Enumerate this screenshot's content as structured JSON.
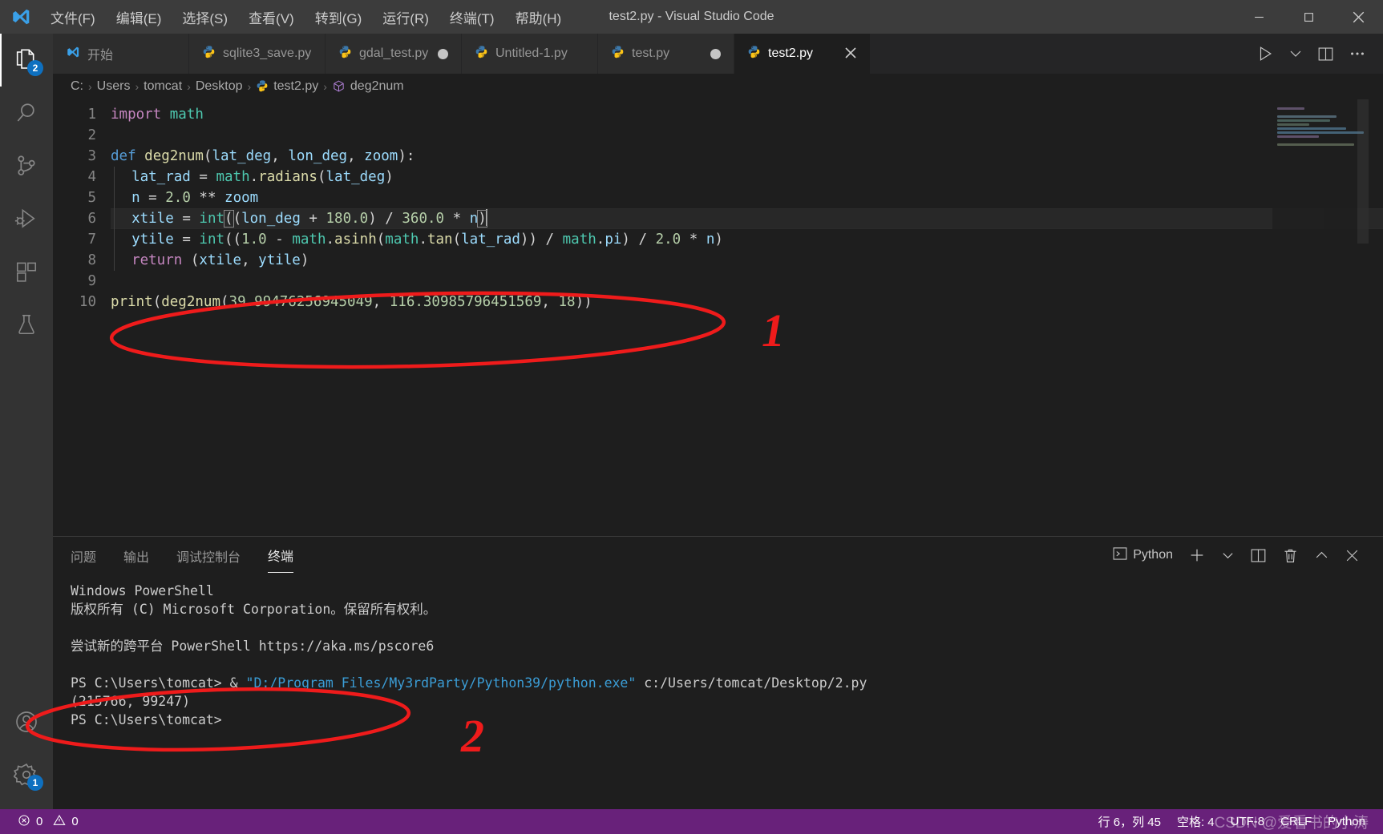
{
  "window": {
    "title": "test2.py - Visual Studio Code",
    "minimize_label": "─",
    "maximize_label": "□",
    "close_label": "✕"
  },
  "menu": {
    "items": [
      {
        "label": "文件(F)",
        "name": "menu-file"
      },
      {
        "label": "编辑(E)",
        "name": "menu-edit"
      },
      {
        "label": "选择(S)",
        "name": "menu-selection"
      },
      {
        "label": "查看(V)",
        "name": "menu-view"
      },
      {
        "label": "转到(G)",
        "name": "menu-go"
      },
      {
        "label": "运行(R)",
        "name": "menu-run"
      },
      {
        "label": "终端(T)",
        "name": "menu-terminal"
      },
      {
        "label": "帮助(H)",
        "name": "menu-help"
      }
    ]
  },
  "activitybar": {
    "items": [
      {
        "name": "explorer-icon",
        "label": "Explorer",
        "badge": "2",
        "active": true
      },
      {
        "name": "search-icon",
        "label": "Search",
        "badge": "",
        "active": false
      },
      {
        "name": "source-control-icon",
        "label": "Source Control",
        "badge": "",
        "active": false
      },
      {
        "name": "run-debug-icon",
        "label": "Run and Debug",
        "badge": "",
        "active": false
      },
      {
        "name": "extensions-icon",
        "label": "Extensions",
        "badge": "",
        "active": false
      },
      {
        "name": "testing-icon",
        "label": "Testing",
        "badge": "",
        "active": false
      }
    ],
    "bottom": [
      {
        "name": "account-icon",
        "label": "Accounts",
        "badge": ""
      },
      {
        "name": "settings-gear-icon",
        "label": "Manage",
        "badge": "1"
      }
    ]
  },
  "tabs": [
    {
      "label": "开始",
      "icon": "vscode-icon",
      "dirty": false,
      "active": false,
      "closable": false
    },
    {
      "label": "sqlite3_save.py",
      "icon": "python-icon",
      "dirty": false,
      "active": false,
      "closable": false
    },
    {
      "label": "gdal_test.py",
      "icon": "python-icon",
      "dirty": true,
      "active": false,
      "closable": false
    },
    {
      "label": "Untitled-1.py",
      "icon": "python-icon",
      "dirty": false,
      "active": false,
      "closable": false
    },
    {
      "label": "test.py",
      "icon": "python-icon",
      "dirty": true,
      "active": false,
      "closable": false
    },
    {
      "label": "test2.py",
      "icon": "python-icon",
      "dirty": false,
      "active": true,
      "closable": true
    }
  ],
  "tab_actions": [
    {
      "name": "run-python-file-button",
      "glyph": "▷"
    },
    {
      "name": "run-options-chevron-icon",
      "glyph": "ˇ"
    },
    {
      "name": "split-editor-right-button",
      "glyph": "◫"
    },
    {
      "name": "more-actions-button",
      "glyph": "⋯"
    }
  ],
  "breadcrumbs": [
    {
      "label": "C:",
      "icon": ""
    },
    {
      "label": "Users",
      "icon": ""
    },
    {
      "label": "tomcat",
      "icon": ""
    },
    {
      "label": "Desktop",
      "icon": ""
    },
    {
      "label": "test2.py",
      "icon": "python-icon"
    },
    {
      "label": "deg2num",
      "icon": "symbol-method-icon"
    }
  ],
  "code": {
    "line_numbers": [
      "1",
      "2",
      "3",
      "4",
      "5",
      "6",
      "7",
      "8",
      "9",
      "10"
    ],
    "lines": [
      "import math",
      "",
      "def deg2num(lat_deg, lon_deg, zoom):",
      "  lat_rad = math.radians(lat_deg)",
      "  n = 2.0 ** zoom",
      "  xtile = int((lon_deg + 180.0) / 360.0 * n)",
      "  ytile = int((1.0 - math.asinh(math.tan(lat_rad)) / math.pi) / 2.0 * n)",
      "  return (xtile, ytile)",
      "",
      "print(deg2num(39.99476256945049, 116.30985796451569, 18))"
    ]
  },
  "panel": {
    "tabs": [
      {
        "label": "问题",
        "name": "panel-tab-problems",
        "active": false
      },
      {
        "label": "输出",
        "name": "panel-tab-output",
        "active": false
      },
      {
        "label": "调试控制台",
        "name": "panel-tab-debug-console",
        "active": false
      },
      {
        "label": "终端",
        "name": "panel-tab-terminal",
        "active": true
      }
    ],
    "terminal_selector_label": "Python",
    "actions": [
      {
        "name": "new-terminal-button",
        "glyph": "＋"
      },
      {
        "name": "terminal-profile-chevron-icon",
        "glyph": "ˇ"
      },
      {
        "name": "split-terminal-button",
        "glyph": "◫"
      },
      {
        "name": "kill-terminal-button",
        "glyph": "🗑"
      },
      {
        "name": "maximize-panel-button",
        "glyph": "⌃"
      },
      {
        "name": "close-panel-button",
        "glyph": "✕"
      }
    ]
  },
  "terminal": {
    "lines": [
      {
        "text": "Windows PowerShell",
        "type": "plain"
      },
      {
        "text": "版权所有 (C) Microsoft Corporation。保留所有权利。",
        "type": "plain"
      },
      {
        "text": "",
        "type": "plain"
      },
      {
        "text": "尝试新的跨平台 PowerShell https://aka.ms/pscore6",
        "type": "plain"
      },
      {
        "text": "",
        "type": "plain"
      },
      {
        "text": "PS C:\\Users\\tomcat> & ",
        "type": "prompt",
        "path": "\"D:/Program Files/My3rdParty/Python39/python.exe\"",
        "tail": " c:/Users/tomcat/Desktop/2.py"
      },
      {
        "text": "(215766, 99247)",
        "type": "plain"
      },
      {
        "text": "PS C:\\Users\\tomcat>",
        "type": "plain"
      }
    ]
  },
  "statusbar": {
    "left": [
      {
        "name": "error-count",
        "icon": "error-icon",
        "label": "0"
      },
      {
        "name": "warning-count",
        "icon": "warning-icon",
        "label": "0"
      }
    ],
    "right": [
      {
        "name": "cursor-position",
        "label": "行 6，列 45"
      },
      {
        "name": "indentation",
        "label": "空格: 4"
      },
      {
        "name": "encoding",
        "label": "UTF-8"
      },
      {
        "name": "eol",
        "label": "CRLF"
      },
      {
        "name": "language-mode",
        "label": "Python"
      }
    ]
  },
  "annotations": {
    "marker_one": "1",
    "marker_two": "2",
    "color": "#ef1b1b"
  },
  "watermark": {
    "text": "CSDN @爱看书的小涛"
  }
}
